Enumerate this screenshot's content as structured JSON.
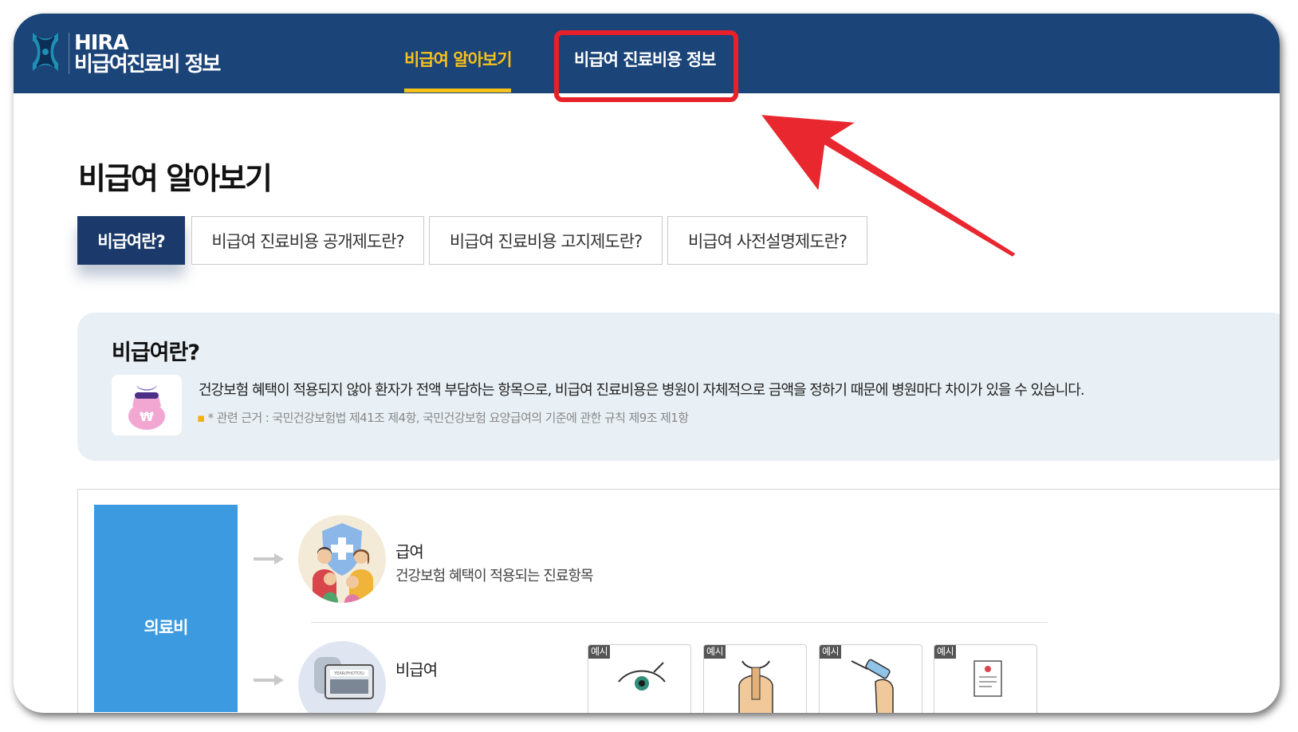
{
  "header": {
    "brand_en": "HIRA",
    "brand_ko": "비급여진료비 정보",
    "nav": [
      {
        "label": "비급여 알아보기",
        "active": true
      },
      {
        "label": "비급여 진료비용 정보",
        "active": false
      }
    ]
  },
  "page_title": "비급여 알아보기",
  "tabs": [
    {
      "label": "비급여란?",
      "active": true
    },
    {
      "label": "비급여 진료비용 공개제도란?",
      "active": false
    },
    {
      "label": "비급여 진료비용 고지제도란?",
      "active": false
    },
    {
      "label": "비급여 사전설명제도란?",
      "active": false
    }
  ],
  "info": {
    "title": "비급여란?",
    "text": "건강보험 혜택이 적용되지 않아 환자가 전액 부담하는 항목으로, 비급여 진료비용은 병원이 자체적으로 금액을 정하기 때문에 병원마다 차이가 있을 수 있습니다.",
    "note": "* 관련 근거 : 국민건강보험법 제41조 제4항, 국민건강보험 요양급여의 기준에 관한 규칙 제9조 제1항"
  },
  "diagram": {
    "medical_cost_label": "의료비",
    "covered": {
      "title": "급여",
      "desc": "건강보험 혜택이 적용되는 진료항목"
    },
    "non_covered": {
      "title": "비급여"
    },
    "example_tag": "예시",
    "monitor_caption": "YEAR(PHOTOS)"
  },
  "colors": {
    "header_bg": "#1b4478",
    "nav_active": "#f6c21a",
    "tab_active_bg": "#1b3a6b",
    "info_bg": "#e9f0f5",
    "medical_block": "#3b9ae0",
    "annotation": "#e8202a"
  },
  "icons": [
    "hira-logo-icon",
    "money-bag-icon",
    "family-shield-icon",
    "monitor-icon",
    "eye-icon",
    "spine-icon",
    "injection-icon",
    "document-icon",
    "arrow-right-icon"
  ]
}
